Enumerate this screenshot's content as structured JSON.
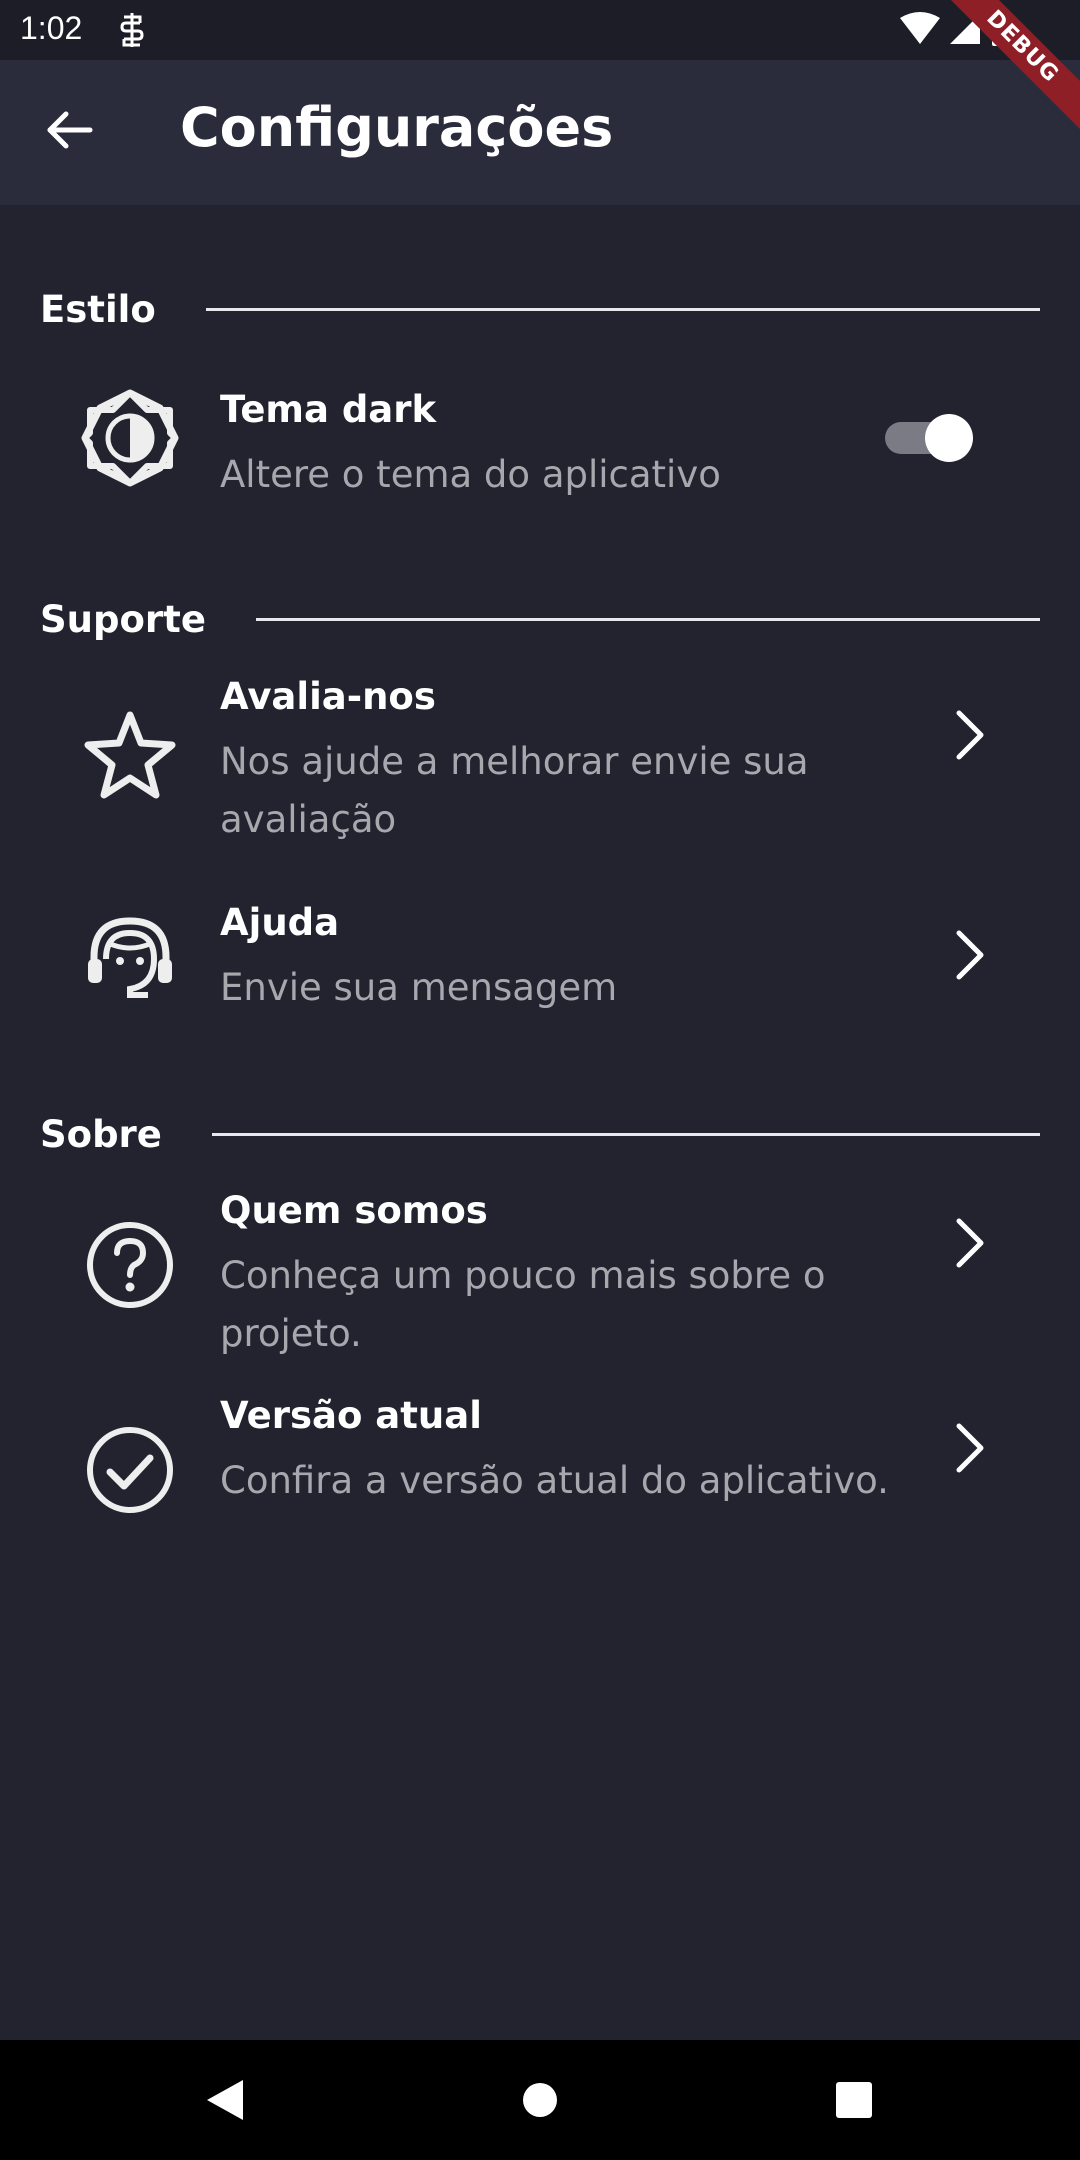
{
  "status_bar": {
    "time": "1:02",
    "debug_label": "DEBUG"
  },
  "app_bar": {
    "title": "Configurações",
    "back_icon": "arrow-left-icon"
  },
  "sections": [
    {
      "title": "Estilo"
    },
    {
      "title": "Suporte"
    },
    {
      "title": "Sobre"
    }
  ],
  "items": {
    "theme": {
      "title": "Tema dark",
      "subtitle": "Altere o tema do aplicativo",
      "icon": "brightness-icon",
      "toggle_on": true
    },
    "rate": {
      "title": "Avalia-nos",
      "subtitle": "Nos ajude a melhorar envie sua avaliação",
      "icon": "star-icon"
    },
    "help": {
      "title": "Ajuda",
      "subtitle": "Envie sua mensagem",
      "icon": "support-agent-icon"
    },
    "about": {
      "title": "Quem somos",
      "subtitle": "Conheça um pouco mais sobre o projeto.",
      "icon": "help-circle-icon"
    },
    "version": {
      "title": "Versão atual",
      "subtitle": "Confira a versão atual do aplicativo.",
      "icon": "check-circle-icon"
    }
  },
  "colors": {
    "background": "#22232f",
    "app_bar": "#2a2c3b",
    "subtitle": "#a7a7ad",
    "debug_ribbon": "#8e1f26"
  }
}
